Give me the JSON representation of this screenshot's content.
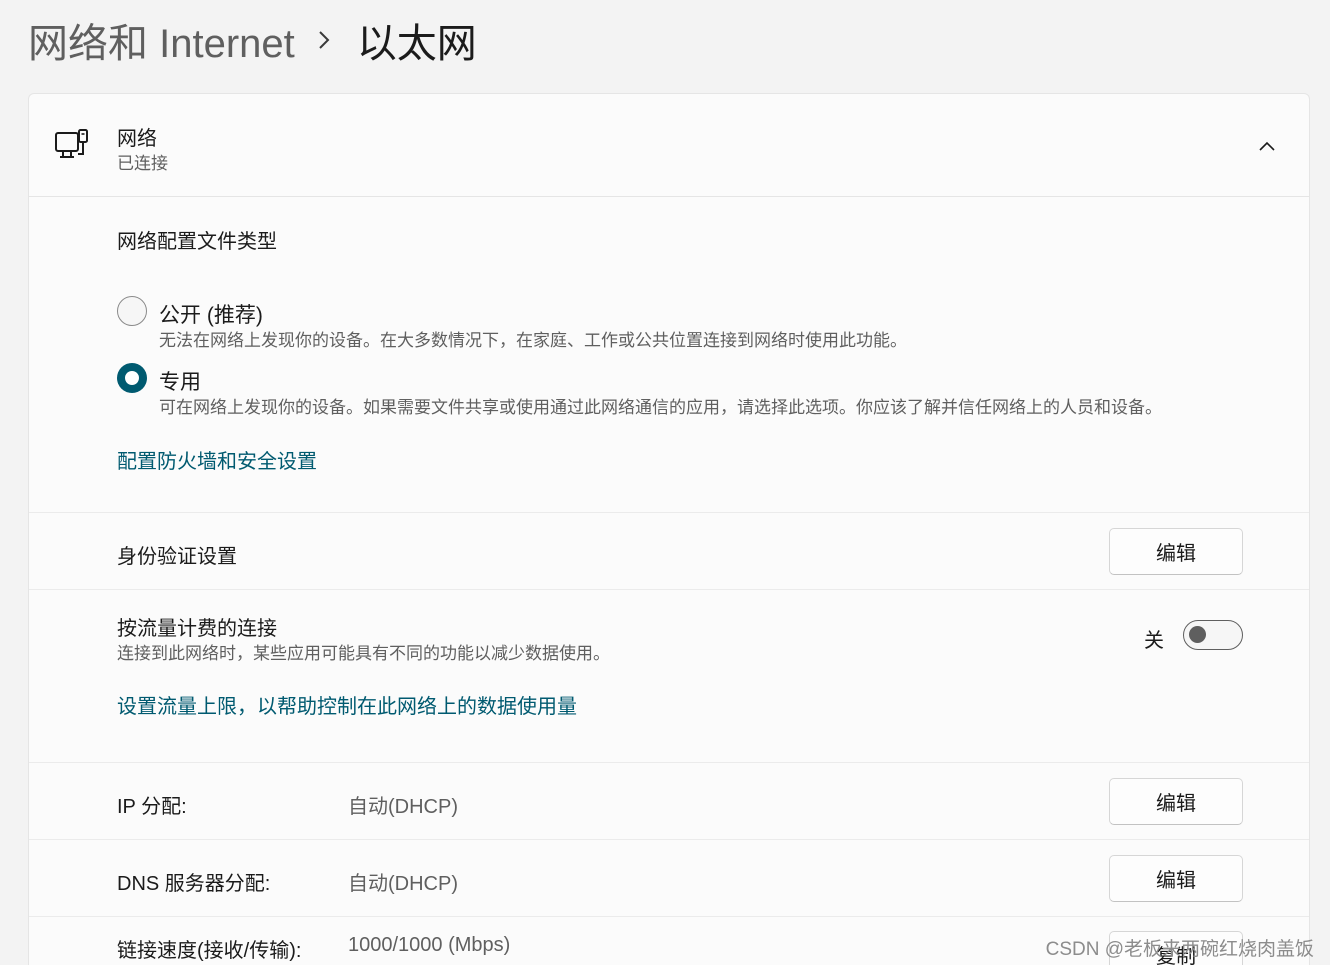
{
  "breadcrumb": {
    "parent": "网络和 Internet",
    "separator_icon": "chevron-right-icon",
    "current": "以太网"
  },
  "network": {
    "icon": "wired-network-icon",
    "title": "网络",
    "status": "已连接",
    "collapse_icon": "chevron-up-icon"
  },
  "profile": {
    "heading": "网络配置文件类型",
    "options": [
      {
        "label": "公开 (推荐)",
        "description": "无法在网络上发现你的设备。在大多数情况下，在家庭、工作或公共位置连接到网络时使用此功能。",
        "selected": false
      },
      {
        "label": "专用",
        "description": "可在网络上发现你的设备。如果需要文件共享或使用通过此网络通信的应用，请选择此选项。你应该了解并信任网络上的人员和设备。",
        "selected": true
      }
    ],
    "firewall_link": "配置防火墙和安全设置"
  },
  "auth": {
    "label": "身份验证设置",
    "button": "编辑"
  },
  "metered": {
    "label": "按流量计费的连接",
    "description": "连接到此网络时，某些应用可能具有不同的功能以减少数据使用。",
    "toggle_state": "关",
    "toggle_on": false,
    "data_limit_link": "设置流量上限，以帮助控制在此网络上的数据使用量"
  },
  "ip": {
    "label": "IP 分配:",
    "value": "自动(DHCP)",
    "button": "编辑"
  },
  "dns": {
    "label": "DNS 服务器分配:",
    "value": "自动(DHCP)",
    "button": "编辑"
  },
  "link_speed": {
    "label": "链接速度(接收/传输):",
    "value": "1000/1000 (Mbps)",
    "button": "复制"
  },
  "watermark": "CSDN @老板来两碗红烧肉盖饭",
  "colors": {
    "accent": "#005a70",
    "background": "#f3f3f3",
    "card": "#fbfbfb"
  }
}
